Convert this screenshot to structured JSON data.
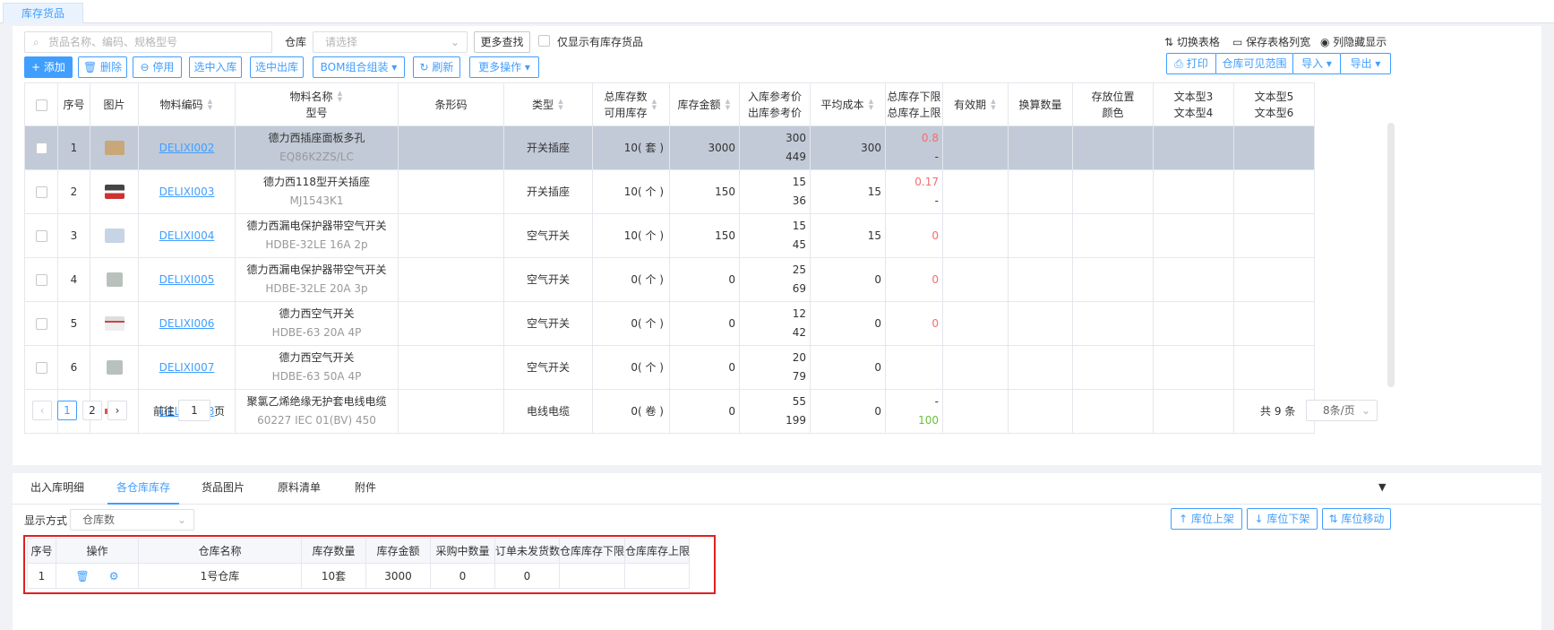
{
  "page_tab": "库存货品",
  "toolbar": {
    "search_placeholder": "货品名称、编码、规格型号",
    "warehouse_label": "仓库",
    "warehouse_placeholder": "请选择",
    "more_search": "更多查找",
    "only_stock": "仅显示有库存货品",
    "switch_table": "切换表格",
    "save_width": "保存表格列宽",
    "show_hidden": "列隐藏显示",
    "add": "添加",
    "delete": "删除",
    "disable": "停用",
    "select_in": "选中入库",
    "select_out": "选中出库",
    "bom": "BOM组合组装",
    "refresh": "刷新",
    "more_ops": "更多操作",
    "print": "打印",
    "visible_range": "仓库可见范围",
    "import": "导入",
    "export": "导出"
  },
  "columns": {
    "no": "序号",
    "image": "图片",
    "code": "物料编码",
    "name1": "物料名称",
    "name2": "型号",
    "barcode": "条形码",
    "type": "类型",
    "stock1": "总库存数",
    "stock2": "可用库存",
    "amount": "库存金额",
    "price1": "入库参考价",
    "price2": "出库参考价",
    "avgcost": "平均成本",
    "limit1": "总库存下限",
    "limit2": "总库存上限",
    "valid": "有效期",
    "convert": "换算数量",
    "loc1": "存放位置",
    "loc2": "颜色",
    "text34a": "文本型3",
    "text34b": "文本型4",
    "text56a": "文本型5",
    "text56b": "文本型6"
  },
  "rows": [
    {
      "no": "1",
      "code": "DELIXI002",
      "name": "德力西插座面板多孔",
      "model": "EQ86K2ZS/LC",
      "type": "开关插座",
      "stock": "10( 套 )",
      "amount": "3000",
      "pin": "300",
      "pout": "449",
      "avg": "300",
      "low": "0.8",
      "high": "-"
    },
    {
      "no": "2",
      "code": "DELIXI003",
      "name": "德力西118型开关插座",
      "model": "MJ1543K1",
      "type": "开关插座",
      "stock": "10( 个 )",
      "amount": "150",
      "pin": "15",
      "pout": "36",
      "avg": "15",
      "low": "0.17",
      "high": "-"
    },
    {
      "no": "3",
      "code": "DELIXI004",
      "name": "德力西漏电保护器带空气开关",
      "model": "HDBE-32LE 16A 2p",
      "type": "空气开关",
      "stock": "10( 个 )",
      "amount": "150",
      "pin": "15",
      "pout": "45",
      "avg": "15",
      "low": "0",
      "high": ""
    },
    {
      "no": "4",
      "code": "DELIXI005",
      "name": "德力西漏电保护器带空气开关",
      "model": "HDBE-32LE 20A 3p",
      "type": "空气开关",
      "stock": "0( 个 )",
      "amount": "0",
      "pin": "25",
      "pout": "69",
      "avg": "0",
      "low": "0",
      "high": ""
    },
    {
      "no": "5",
      "code": "DELIXI006",
      "name": "德力西空气开关",
      "model": "HDBE-63 20A 4P",
      "type": "空气开关",
      "stock": "0( 个 )",
      "amount": "0",
      "pin": "12",
      "pout": "42",
      "avg": "0",
      "low": "0",
      "high": ""
    },
    {
      "no": "6",
      "code": "DELIXI007",
      "name": "德力西空气开关",
      "model": "HDBE-63 50A 4P",
      "type": "空气开关",
      "stock": "0( 个 )",
      "amount": "0",
      "pin": "20",
      "pout": "79",
      "avg": "0",
      "low": "",
      "high": ""
    },
    {
      "no": "7",
      "code": "DELIXI008",
      "name": "聚氯乙烯绝缘无护套电线电缆",
      "model": "60227 IEC 01(BV) 450",
      "type": "电线电缆",
      "stock": "0( 卷 )",
      "amount": "0",
      "pin": "55",
      "pout": "199",
      "avg": "0",
      "low": "-",
      "high": "100"
    }
  ],
  "pager": {
    "page1": "1",
    "page2": "2",
    "goto_prefix": "前往",
    "goto_value": "1",
    "goto_suffix": "页",
    "total": "共 9 条",
    "page_size": "8条/页"
  },
  "bottom_tabs": [
    "出入库明细",
    "各仓库库存",
    "货品图片",
    "原料清单",
    "附件"
  ],
  "display_label": "显示方式",
  "display_value": "仓库数",
  "shelf_up": "库位上架",
  "shelf_down": "库位下架",
  "shelf_move": "库位移动",
  "wh_columns": [
    "序号",
    "操作",
    "仓库名称",
    "库存数量",
    "库存金额",
    "采购中数量",
    "订单未发货数",
    "仓库库存下限",
    "仓库库存上限"
  ],
  "wh_row": {
    "no": "1",
    "name": "1号仓库",
    "qty": "10套",
    "amount": "3000",
    "purchasing": "0",
    "unshipped": "0",
    "low": "",
    "high": ""
  },
  "colors": {
    "accent": "#409eff",
    "selected_row": "#c2cad7",
    "alert": "#f56c6c",
    "ok": "#67c23a",
    "highlight_box": "#e02020"
  }
}
